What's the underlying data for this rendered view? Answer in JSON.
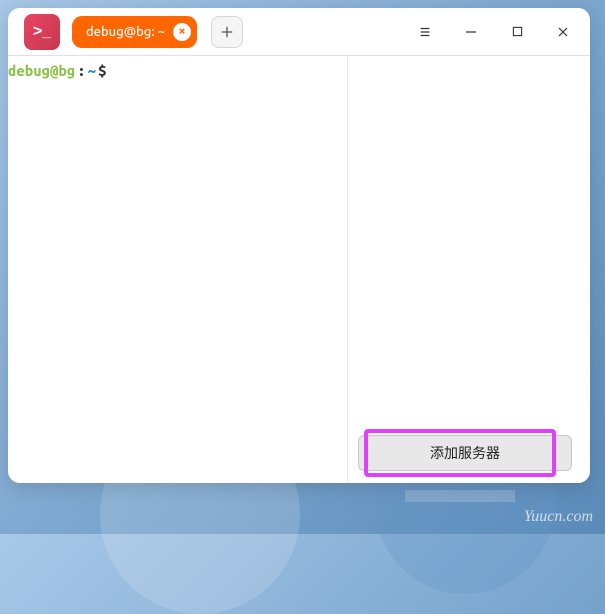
{
  "app": {
    "icon_glyph": ">_"
  },
  "tab": {
    "label": "debug@bg: ~"
  },
  "terminal": {
    "user_host": "debug@bg",
    "separator": ":",
    "path": "~",
    "prompt": "$"
  },
  "buttons": {
    "add_server": "添加服务器"
  },
  "watermark": "Yuucn.com"
}
